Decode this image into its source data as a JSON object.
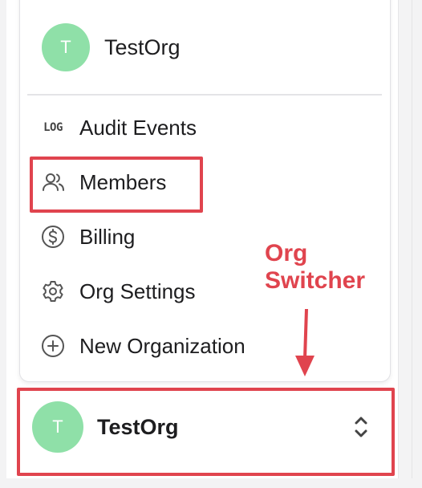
{
  "menu": {
    "current_org": {
      "avatar_initial": "T",
      "name": "TestOrg"
    },
    "items": [
      {
        "label": "Audit Events",
        "icon": "log-icon",
        "icon_text": "LOG"
      },
      {
        "label": "Members",
        "icon": "users-icon"
      },
      {
        "label": "Billing",
        "icon": "dollar-circle-icon"
      },
      {
        "label": "Org Settings",
        "icon": "gear-icon"
      },
      {
        "label": "New Organization",
        "icon": "plus-circle-icon"
      }
    ]
  },
  "annotation": {
    "line1": "Org",
    "line2": "Switcher",
    "color": "#e0444e"
  },
  "switcher": {
    "avatar_initial": "T",
    "name": "TestOrg",
    "icon": "chevron-up-down-icon"
  },
  "colors": {
    "avatar": "#8fe0a8",
    "highlight": "#e0444e"
  }
}
